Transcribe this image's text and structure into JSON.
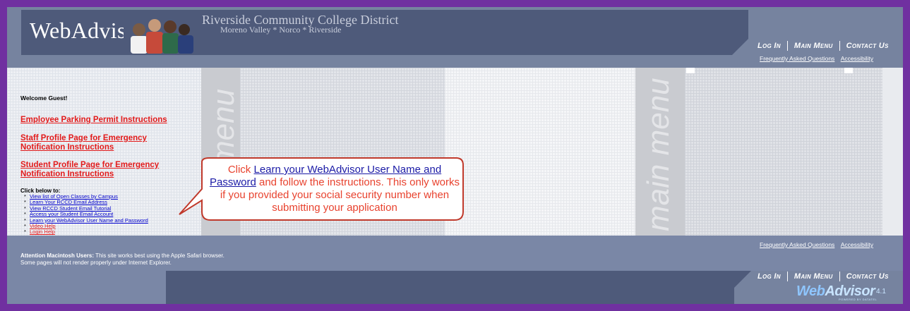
{
  "header": {
    "logo_text": "WebAdvisor",
    "district_name": "Riverside Community College District",
    "district_campuses": "Moreno Valley * Norco * Riverside",
    "nav": {
      "login": "Log In",
      "main_menu": "Main Menu",
      "contact_us": "Contact Us"
    },
    "faq_link": "Frequently Asked Questions",
    "accessibility_link": "Accessibility"
  },
  "main": {
    "welcome": "Welcome Guest!",
    "links": {
      "parking": "Employee Parking Permit Instructions",
      "staff_profile_line1": "Staff Profile Page for Emergency",
      "staff_profile_line2": "Notification Instructions",
      "student_profile_line1": "Student Profile Page for Emergency",
      "student_profile_line2": "Notification Instructions"
    },
    "decor_word_left": "menu",
    "decor_word_right": "main menu",
    "click_below": "Click below to:",
    "quick_links": [
      "View list of Open Classes by Campus",
      "Learn Your RCCD Email Address",
      "View RCCD Student Email Tutorial",
      "Access your Student Email Account",
      "Learn your WebAdvisor User Name and Password",
      "Video Help",
      "Login Help"
    ]
  },
  "callout": {
    "prefix": "Click ",
    "link": "Learn your WebAdvisor User Name and Password",
    "suffix": " and follow the instructions. This only works if you provided your social security number when submitting your application",
    "text_color": "#e8422e",
    "link_color": "#1a1aa6",
    "border_color": "#c0392b"
  },
  "footer": {
    "attention_label": "Attention Macintosh Users:",
    "attention_text": " This site works best using the Apple Safari browser.",
    "attention_text2": "Some pages will not render properly under Internet Explorer.",
    "faq_link": "Frequently Asked Questions",
    "accessibility_link": "Accessibility",
    "nav": {
      "login": "Log In",
      "main_menu": "Main Menu",
      "contact_us": "Contact Us"
    },
    "brand_web": "Web",
    "brand_advisor": "Advisor",
    "brand_version": "4.1",
    "powered_by": "POWERED BY DATATEL"
  },
  "colors": {
    "page_border": "#7030a0",
    "header_dark": "#4e5a7a",
    "header_light": "#76839f",
    "red_link": "#e31b1b",
    "blue_link": "#0000cc"
  }
}
